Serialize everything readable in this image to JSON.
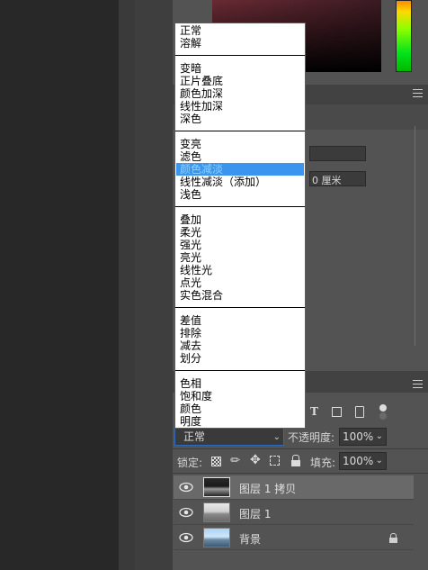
{
  "properties": {
    "unit_value": "0 厘米"
  },
  "blend_modes": {
    "groups": [
      [
        "正常",
        "溶解"
      ],
      [
        "变暗",
        "正片叠底",
        "颜色加深",
        "线性加深",
        "深色"
      ],
      [
        "变亮",
        "滤色",
        "颜色减淡",
        "线性减淡（添加）",
        "浅色"
      ],
      [
        "叠加",
        "柔光",
        "强光",
        "亮光",
        "线性光",
        "点光",
        "实色混合"
      ],
      [
        "差值",
        "排除",
        "减去",
        "划分"
      ],
      [
        "色相",
        "饱和度",
        "颜色",
        "明度"
      ]
    ],
    "selected": "颜色减淡",
    "current_value": "正常"
  },
  "layers_panel": {
    "opacity_label": "不透明度:",
    "opacity_value": "100%",
    "lock_label": "锁定:",
    "fill_label": "填充:",
    "fill_value": "100%",
    "layers": [
      {
        "name": "图层 1 拷贝",
        "selected": true
      },
      {
        "name": "图层 1",
        "selected": false
      },
      {
        "name": "背景",
        "selected": false,
        "locked": true
      }
    ]
  },
  "colors": {
    "selection": "#3b95ee",
    "panel_bg": "#535353",
    "canvas_bg": "#282828"
  }
}
